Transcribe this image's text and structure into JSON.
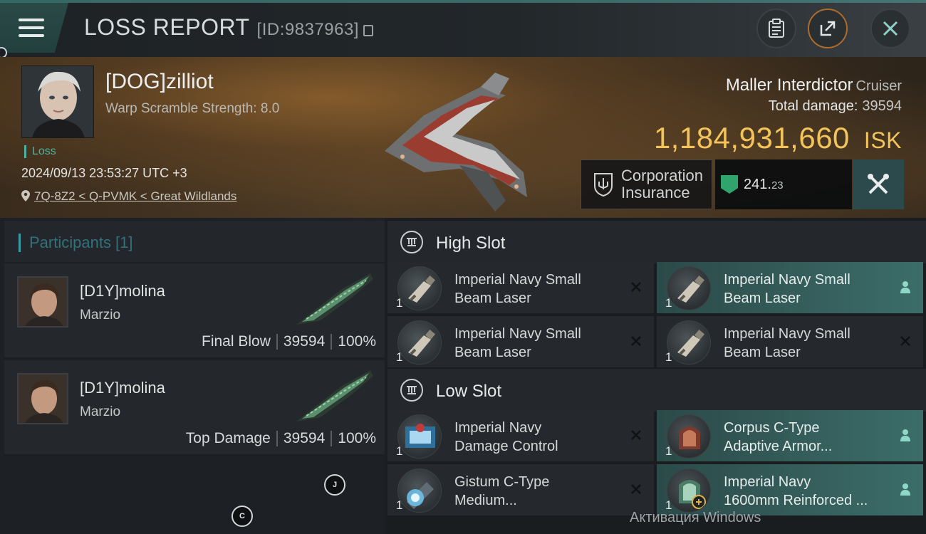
{
  "header": {
    "title": "LOSS REPORT",
    "report_id": "[ID:9837963]",
    "buttons": [
      "clipboard-icon",
      "share-icon",
      "close-icon"
    ],
    "accent": "#4fa39a"
  },
  "victim": {
    "name": "[DOG]zilliot",
    "warp_scramble": "Warp Scramble Strength: 8.0",
    "status": "Loss",
    "datetime": "2024/09/13 23:53:27 UTC +3",
    "location": "7Q-8Z2 < Q-PVMK < Great Wildlands"
  },
  "ship": {
    "name": "Maller Interdictor",
    "class": "Cruiser",
    "total_damage_label": "Total damage:",
    "total_damage": "39594",
    "value": "1,184,931,660",
    "currency": "ISK",
    "value_color": "#f2c45a"
  },
  "insurance": {
    "label_line1": "Corporation",
    "label_line2": "Insurance",
    "value_main": "241.",
    "value_decimal": "23"
  },
  "participants": {
    "title": "Participants [1]",
    "items": [
      {
        "name": "[D1Y]molina",
        "ship": "Marzio",
        "role": "Final Blow",
        "damage": "39594",
        "percent": "100%"
      },
      {
        "name": "[D1Y]molina",
        "ship": "Marzio",
        "role": "Top Damage",
        "damage": "39594",
        "percent": "100%"
      }
    ],
    "floating_markers": [
      "J",
      "C"
    ]
  },
  "slots": {
    "high": {
      "title": "High Slot",
      "modules": [
        {
          "line1": "Imperial Navy Small",
          "line2": "Beam Laser",
          "qty": "1",
          "state": "destroyed"
        },
        {
          "line1": "Imperial Navy Small",
          "line2": "Beam Laser",
          "qty": "1",
          "state": "dropped"
        },
        {
          "line1": "Imperial Navy Small",
          "line2": "Beam Laser",
          "qty": "1",
          "state": "destroyed"
        },
        {
          "line1": "Imperial Navy Small",
          "line2": "Beam Laser",
          "qty": "1",
          "state": "destroyed"
        }
      ]
    },
    "low": {
      "title": "Low Slot",
      "modules": [
        {
          "line1": "Imperial Navy",
          "line2": "Damage Control",
          "qty": "1",
          "state": "destroyed"
        },
        {
          "line1": "Corpus C-Type",
          "line2": "Adaptive Armor...",
          "qty": "1",
          "state": "dropped"
        },
        {
          "line1": "Gistum C-Type",
          "line2": "Medium...",
          "qty": "1",
          "state": "destroyed"
        },
        {
          "line1": "Imperial Navy",
          "line2": "1600mm Reinforced ...",
          "qty": "1",
          "state": "dropped"
        }
      ]
    }
  },
  "os_watermark": "Активация Windows"
}
